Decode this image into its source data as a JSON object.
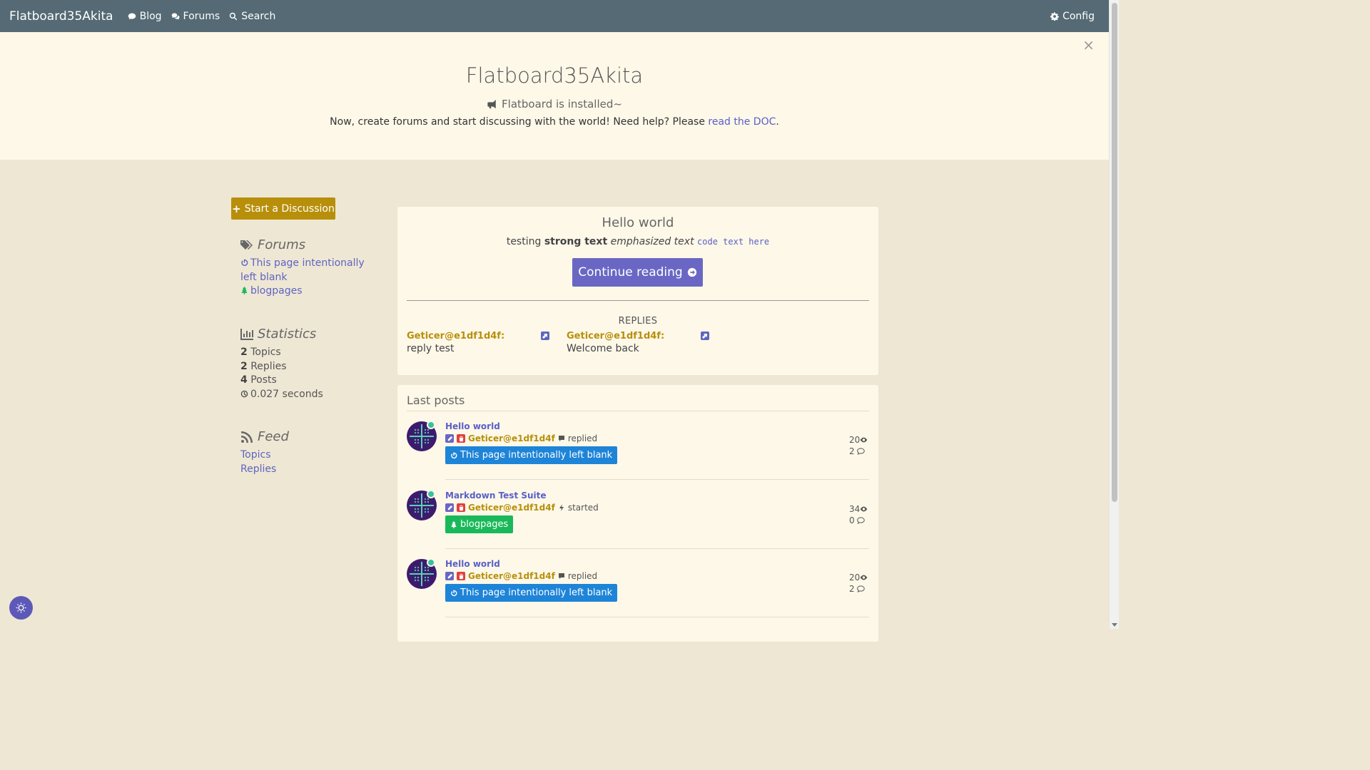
{
  "navbar": {
    "brand": "Flatboard35Akita",
    "blog": "Blog",
    "forums": "Forums",
    "search": "Search",
    "config": "Config"
  },
  "jumbo": {
    "close": "×",
    "title": "Flatboard35Akita",
    "subtitle": "Flatboard is installed~",
    "text_before": "Now, create forums and start discussing with the world! Need help? Please ",
    "link": "read the DOC",
    "text_after": "."
  },
  "sidebar": {
    "start_button": "Start a Discussion",
    "forums_heading": "Forums",
    "forums": [
      {
        "label": "This page intentionally left blank",
        "color": "#6064c0"
      },
      {
        "label": "blogpages",
        "color": "#19b95a"
      }
    ],
    "stats_heading": "Statistics",
    "stats": {
      "topics_n": "2",
      "topics_label": "Topics",
      "replies_n": "2",
      "replies_label": "Replies",
      "posts_n": "4",
      "posts_label": "Posts",
      "time": "0.027 seconds"
    },
    "feed_heading": "Feed",
    "feed": [
      "Topics",
      "Replies"
    ]
  },
  "featured": {
    "title": "Hello world",
    "excerpt_plain": "testing ",
    "excerpt_strong": "strong text",
    "excerpt_em": "emphasized text",
    "excerpt_code": "code text here",
    "continue": "Continue reading",
    "replies_title": "REPLIES",
    "replies": [
      {
        "author": "Geticer@e1df1d4f",
        "colon": ":",
        "text": "reply test"
      },
      {
        "author": "Geticer@e1df1d4f",
        "colon": ":",
        "text": "Welcome back"
      }
    ]
  },
  "last_posts": {
    "heading": "Last posts",
    "items": [
      {
        "title": "Hello world",
        "author": "Geticer@e1df1d4f",
        "action": "replied",
        "tag": "This page intentionally left blank",
        "views": "20",
        "comments": "2"
      },
      {
        "title": "Markdown Test Suite",
        "author": "Geticer@e1df1d4f",
        "action": "started",
        "tag": "blogpages",
        "views": "34",
        "comments": "0"
      },
      {
        "title": "Hello world",
        "author": "Geticer@e1df1d4f",
        "action": "replied",
        "tag": "This page intentionally left blank",
        "views": "20",
        "comments": "2"
      }
    ]
  },
  "colors": {
    "navbar": "#556a74",
    "accent": "#6a67c4",
    "gold": "#b88f0a",
    "tag_blue": "#1e84d8",
    "tag_green": "#19b95a"
  }
}
